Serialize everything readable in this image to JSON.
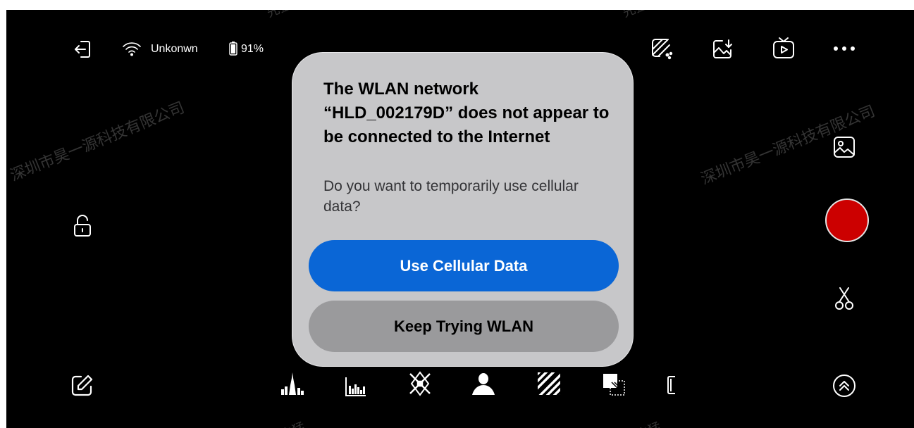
{
  "status_bar": {
    "wifi_name": "Unkonwn",
    "battery": "91%"
  },
  "watermark": {
    "text": "深圳市昊一源科技有限公司",
    "fragment": "先猛"
  },
  "icons": {
    "exit": "exit-icon",
    "wifi": "wifi-icon",
    "battery": "battery-icon",
    "image_edit": "image-edit-icon",
    "image_download": "image-download-icon",
    "tv_play": "tv-play-icon",
    "more": "more-icon",
    "gallery": "gallery-icon",
    "lock": "unlock-icon",
    "scissors": "scissors-icon",
    "edit": "edit-icon",
    "expand": "chevrons-up-icon"
  },
  "dialog": {
    "title": "The WLAN network “HLD_002179D” does not appear to be connected to the Internet",
    "message": "Do you want to temporarily use cellular data?",
    "primary_button": "Use Cellular Data",
    "secondary_button": "Keep Trying WLAN"
  },
  "colors": {
    "record": "#cc0000",
    "primary_button": "#0a66d6",
    "dialog_bg": "#c7c7c9"
  }
}
